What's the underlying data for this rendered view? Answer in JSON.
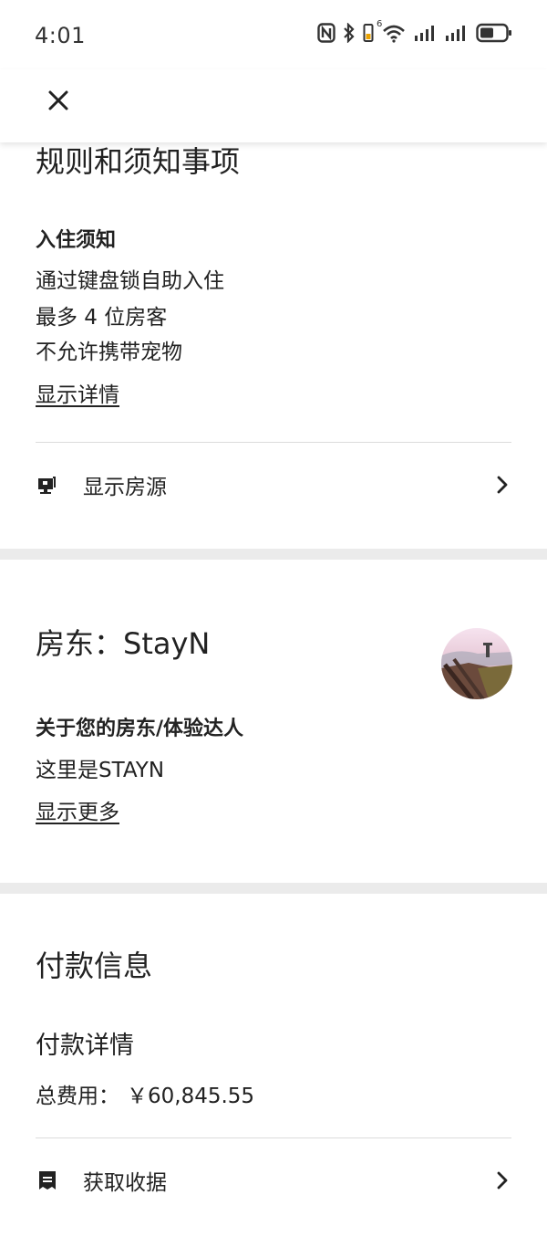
{
  "status_bar": {
    "time": "4:01",
    "icons": [
      "nfc-icon",
      "bluetooth-icon",
      "vibrate-icon",
      "wifi-icon",
      "signal-icon",
      "signal-icon",
      "battery-icon"
    ],
    "wifi_badge": "6"
  },
  "top_bar": {
    "close_icon": "close-icon"
  },
  "rules": {
    "title": "规则和须知事项",
    "checkin_heading": "入住须知",
    "items": [
      "通过键盘锁自助入住",
      "最多 4 位房客",
      "不允许携带宠物"
    ],
    "details_link": "显示详情",
    "listing_row": {
      "icon": "listing-icon",
      "label": "显示房源"
    }
  },
  "host": {
    "title": "房东：StayN",
    "about_heading": "关于您的房东/体验达人",
    "about_text": "这里是STAYN",
    "more_link": "显示更多"
  },
  "payment": {
    "title": "付款信息",
    "details_heading": "付款详情",
    "total_label": "总费用：",
    "total_value": "￥60,845.55",
    "receipt_row": {
      "icon": "receipt-icon",
      "label": "获取收据"
    }
  },
  "colors": {
    "text": "#222222",
    "divider": "#dcdcdc",
    "band": "#ebebeb"
  }
}
